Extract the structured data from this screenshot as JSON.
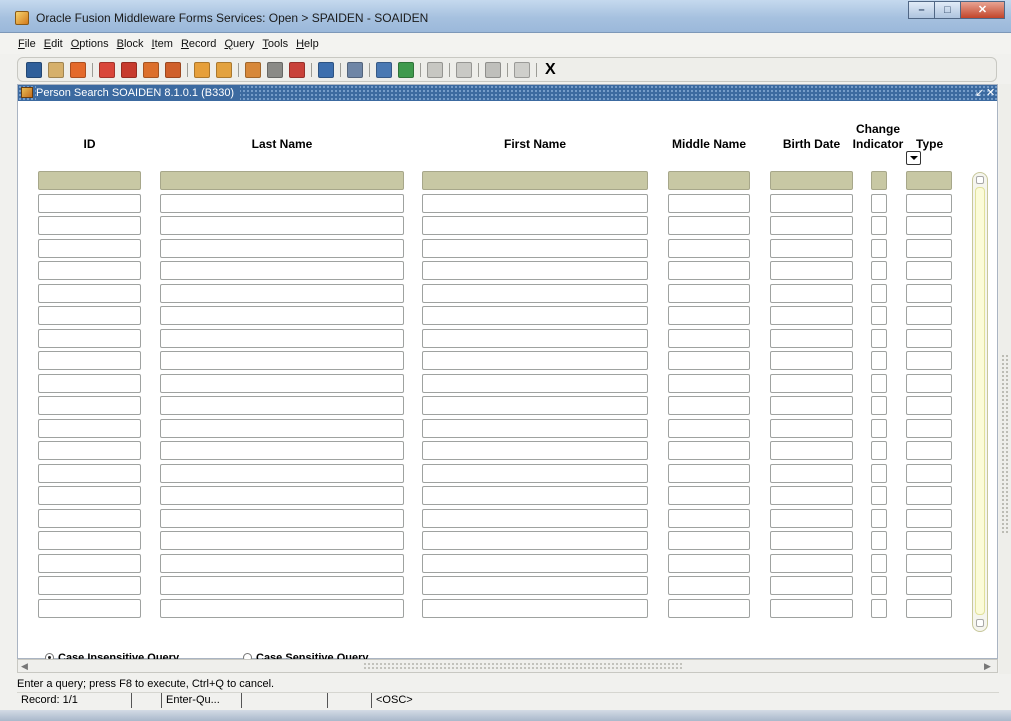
{
  "window": {
    "title": "Oracle Fusion Middleware Forms Services:  Open > SPAIDEN - SOAIDEN",
    "buttons": [
      "minimize-icon",
      "maximize-icon",
      "close-icon"
    ]
  },
  "menu": [
    "File",
    "Edit",
    "Options",
    "Block",
    "Item",
    "Record",
    "Query",
    "Tools",
    "Help"
  ],
  "toolbar": {
    "icons": [
      "save-icon",
      "rollback-icon",
      "select-icon",
      "insert-record-icon",
      "remove-record-icon",
      "previous-block-icon",
      "next-block-icon",
      "previous-record-icon",
      "next-record-icon",
      "enter-query-icon",
      "execute-query-icon",
      "cancel-query-icon",
      "print-icon",
      "export-icon",
      "search-icon",
      "item-help-icon",
      "options-icon",
      "attachments-icon",
      "help-icon",
      "lightbulb-icon"
    ],
    "exit_label": "X"
  },
  "form": {
    "title": "Person Search  SOAIDEN  8.1.0.1  (B330)",
    "controls": [
      "↙",
      "✕"
    ]
  },
  "columns": {
    "id": "ID",
    "last_name": "Last Name",
    "first_name": "First Name",
    "middle_name": "Middle Name",
    "birth_date": "Birth Date",
    "change_line1": "Change",
    "change_line2": "Indicator",
    "type": "Type"
  },
  "query_options": {
    "case_insensitive": "Case Insensitive Query",
    "case_sensitive": "Case Sensitive Query",
    "selected": "case_insensitive"
  },
  "status": {
    "message": "Enter a query;  press F8 to execute, Ctrl+Q to cancel.",
    "record": "Record: 1/1",
    "seg2": "",
    "mode": "Enter-Qu...",
    "seg4": "",
    "seg5": "",
    "osc": "<OSC>"
  },
  "colors": {
    "current_record": "#c8c8a4",
    "form_title_bg": "#3c6aa0"
  }
}
